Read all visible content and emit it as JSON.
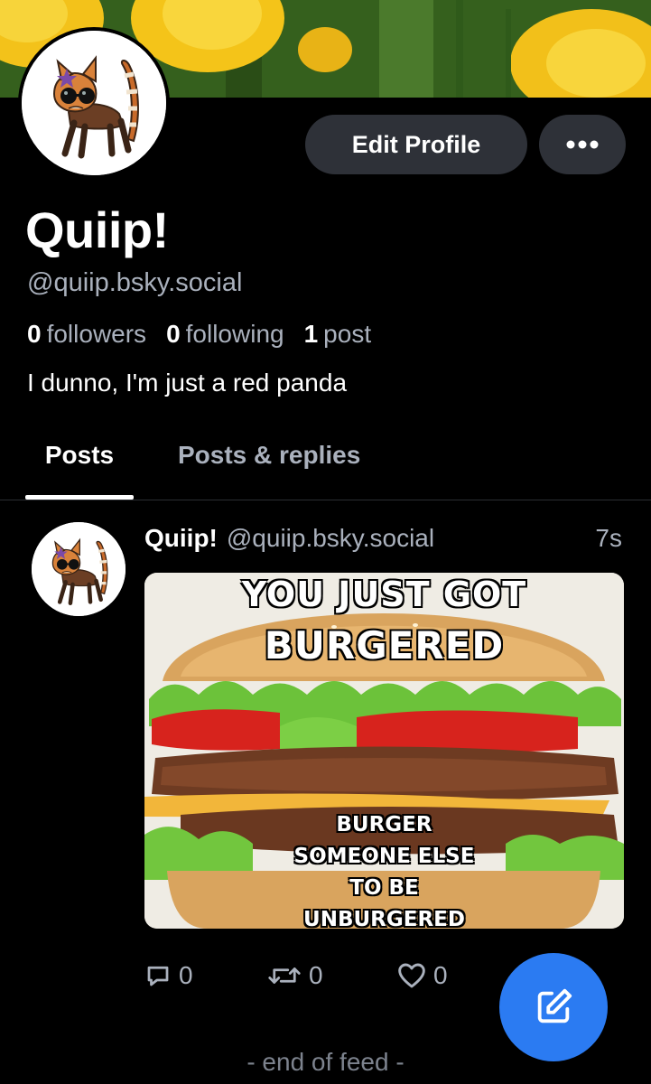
{
  "profile": {
    "display_name": "Quiip!",
    "handle": "@quiip.bsky.social",
    "bio": "I dunno, I'm just a red panda",
    "stats": {
      "followers_count": "0",
      "followers_label": "followers",
      "following_count": "0",
      "following_label": "following",
      "posts_count": "1",
      "posts_label": "post"
    }
  },
  "header": {
    "edit_profile_label": "Edit Profile",
    "more_icon": "more-dots-icon"
  },
  "tabs": [
    {
      "label": "Posts",
      "active": true
    },
    {
      "label": "Posts & replies",
      "active": false
    }
  ],
  "feed": {
    "posts": [
      {
        "author": "Quiip!",
        "handle": "@quiip.bsky.social",
        "time": "7s",
        "image": {
          "text_line1": "YOU JUST GOT",
          "text_line2": "BURGERED",
          "text_bottom": [
            "BURGER",
            "SOMEONE ELSE",
            "TO BE",
            "UNBURGERED"
          ]
        },
        "reply_count": "0",
        "repost_count": "0",
        "like_count": "0"
      }
    ],
    "end_text": "- end of feed -"
  },
  "colors": {
    "background": "#000000",
    "button_bg": "#2e3138",
    "muted_text": "#aab1bd",
    "fab": "#2b7bf2"
  }
}
